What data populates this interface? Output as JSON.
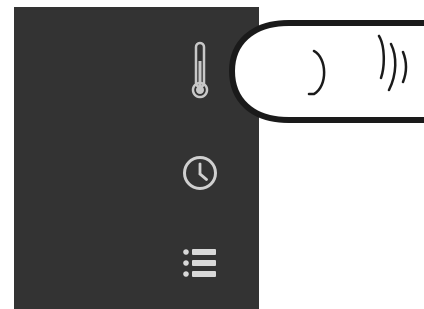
{
  "sidebar": {
    "background_color": "#333333",
    "items": [
      {
        "icon": "thermometer-icon"
      },
      {
        "icon": "clock-icon"
      },
      {
        "icon": "list-icon"
      }
    ]
  },
  "overlay": {
    "icon": "finger-icon"
  }
}
